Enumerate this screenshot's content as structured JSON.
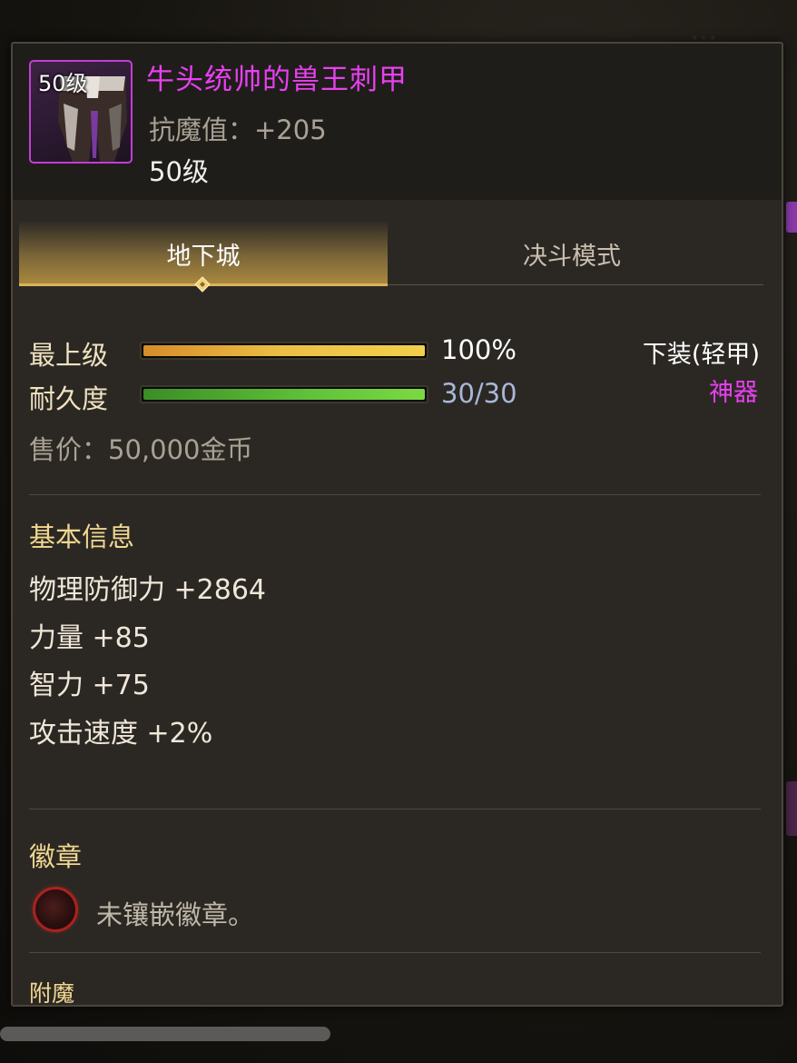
{
  "item": {
    "icon_name": "lower-armor-icon",
    "icon_level_label": "50级",
    "name": "牛头统帅的兽王刺甲",
    "name_color": "#e840f0",
    "magic_resistance": "抗魔值：+205",
    "level": "50级"
  },
  "tabs": [
    {
      "label": "地下城",
      "active": true
    },
    {
      "label": "决斗模式",
      "active": false
    }
  ],
  "stats": {
    "grade": {
      "label": "最上级",
      "value": "100%",
      "fraction": 1.0,
      "value_color": "#ffffff"
    },
    "durability": {
      "label": "耐久度",
      "value": "30/30",
      "fraction": 1.0,
      "value_color": "#a9b8d8"
    },
    "slot_type": "下装(轻甲)",
    "rarity": "神器",
    "rarity_color": "#e840f0",
    "price": "售价：50,000金币"
  },
  "basic_info": {
    "title": "基本信息",
    "lines": [
      "物理防御力 +2864",
      "力量 +85",
      "智力 +75",
      "攻击速度 +2%"
    ]
  },
  "emblem": {
    "title": "徽章",
    "slot_icon": "empty-emblem-slot-icon",
    "text": "未镶嵌徽章。"
  },
  "enchant": {
    "title": "附魔"
  }
}
